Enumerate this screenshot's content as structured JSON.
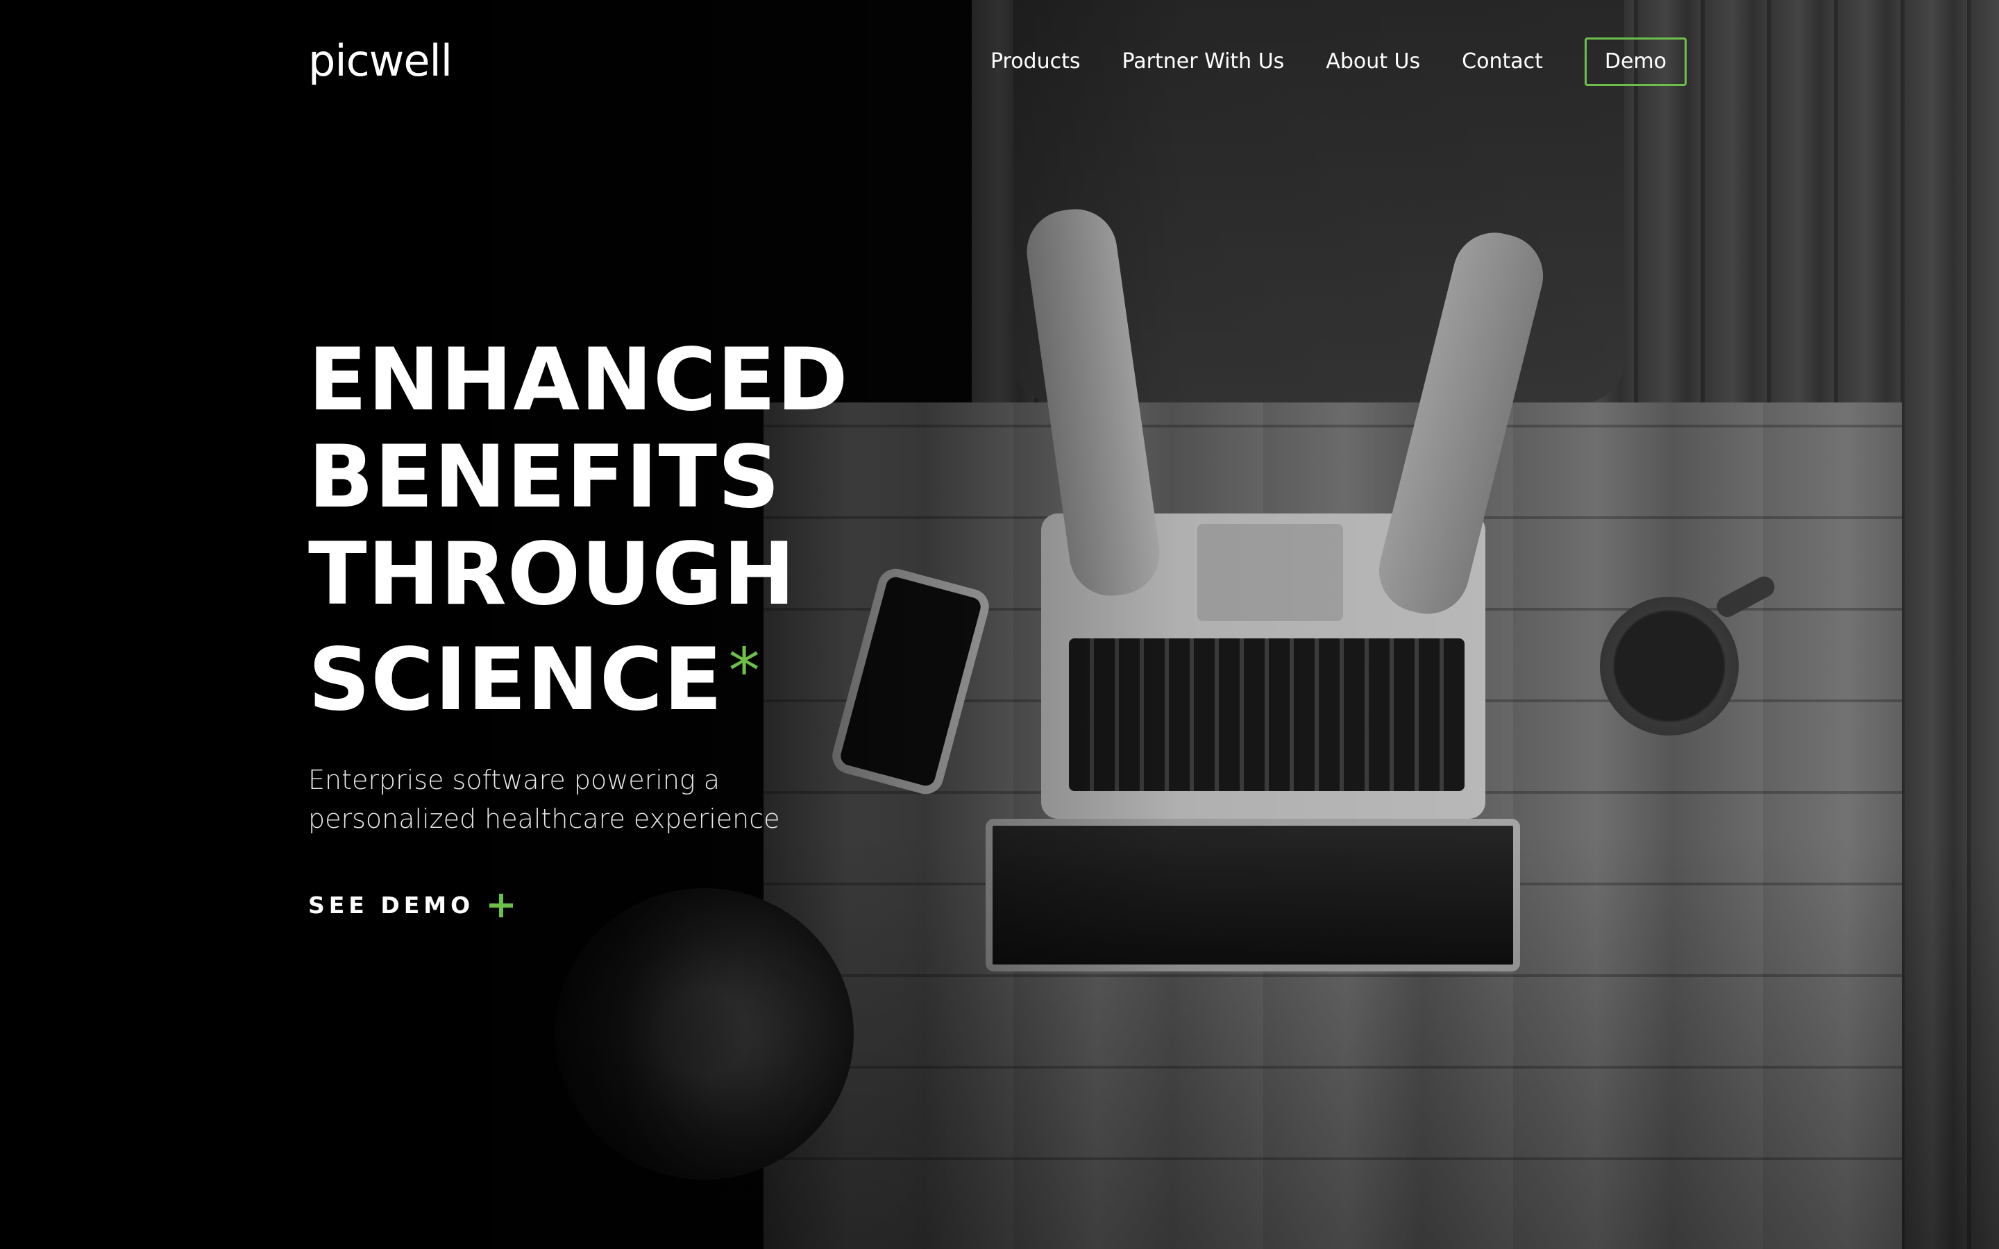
{
  "brand": {
    "logo_text": "picwell",
    "accent_color": "#6cc04a"
  },
  "nav": {
    "links": [
      {
        "label": "Products"
      },
      {
        "label": "Partner With Us"
      },
      {
        "label": "About Us"
      },
      {
        "label": "Contact"
      }
    ],
    "demo_label": "Demo"
  },
  "hero": {
    "headline_lines": [
      "ENHANCED",
      "BENEFITS",
      "THROUGH",
      "SCIENCE"
    ],
    "headline_asterisk": "*",
    "subtitle_lines": [
      "Enterprise software powering a",
      "personalized healthcare experience"
    ],
    "cta_label": "SEE DEMO",
    "cta_icon": "plus-icon",
    "background_image": "grayscale-photo-person-typing-laptop-on-wooden-table"
  }
}
